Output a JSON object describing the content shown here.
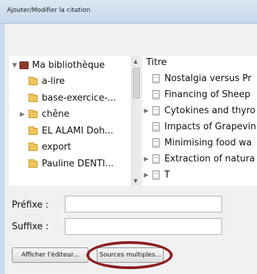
{
  "window": {
    "title": "Ajouter/Modifier la citation"
  },
  "library": {
    "root": "Ma bibliothèque",
    "collections": [
      "a-lire",
      "base-exercice-...",
      "chêne",
      "EL ALAMI Doh...",
      "export",
      "Pauline DENTI..."
    ]
  },
  "items": {
    "column_header": "Titre",
    "rows": [
      "Nostalgia versus Pr",
      "Financing of Sheep",
      "Cytokines and thyro",
      "Impacts of Grapevin",
      "Minimising food wa",
      "Extraction of natura",
      "T"
    ]
  },
  "form": {
    "prefix_label": "Préfixe :",
    "suffix_label": "Suffixe :"
  },
  "buttons": {
    "editor": "Afficher l'éditeur...",
    "multiple_sources": "Sources multiples..."
  }
}
